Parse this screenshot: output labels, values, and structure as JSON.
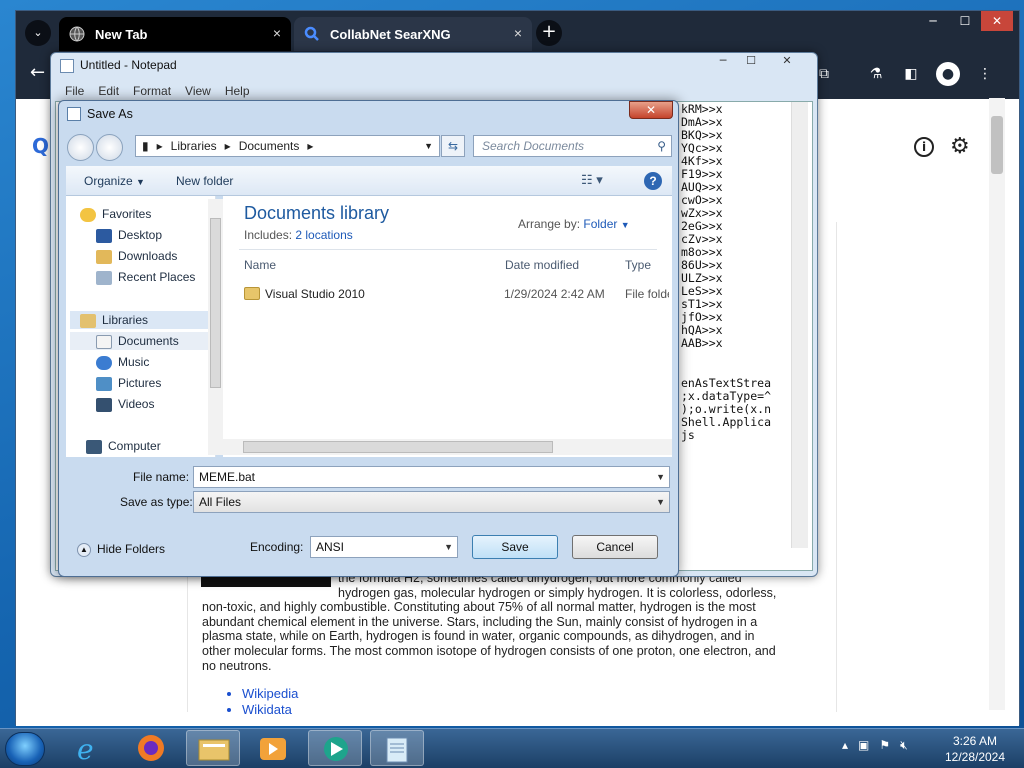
{
  "browser": {
    "tabs": [
      {
        "label": "New Tab",
        "close": "×"
      },
      {
        "label": "CollabNet SearXNG",
        "close": "×"
      }
    ],
    "new_tab": "+",
    "tab_menu": "⌄",
    "window_controls": {
      "minimize": "─",
      "maximize": "☐",
      "close": "✕"
    },
    "toolbar_icons": [
      "puzzle-icon",
      "flask-icon",
      "sidepanel-icon",
      "profile-icon",
      "more-icon"
    ]
  },
  "page": {
    "article_lines": [
      "the formula H2, sometimes called dihydrogen, but more commonly called",
      "hydrogen gas, molecular hydrogen or simply hydrogen. It is colorless, odorless,",
      "non-toxic, and highly combustible. Constituting about 75% of all normal matter, hydrogen is the most",
      "abundant chemical element in the universe. Stars, including the Sun, mainly consist of hydrogen in a",
      "plasma state, while on Earth, hydrogen is found in water, organic compounds, as dihydrogen, and in",
      "other molecular forms. The most common isotope of hydrogen consists of one proton, one electron, and",
      "no neutrons."
    ],
    "links": [
      "Wikipedia",
      "Wikidata"
    ]
  },
  "notepad": {
    "title": "Untitled - Notepad",
    "menu": [
      "File",
      "Edit",
      "Format",
      "View",
      "Help"
    ],
    "text_top": "kRM>>x\nDmA>>x\nBKQ>>x\nYQc>>x\n4Kf>>x\nF19>>x\nAUQ>>x\ncwO>>x\nwZx>>x\n2eG>>x\ncZv>>x\nm8o>>x\n86U>>x\nULZ>>x\nLeS>>x\nsT1>>x\njfO>>x\nhQA>>x\nAAB>>x",
    "text_bottom": "enAsTextStrea\n;x.dataType=^\n);o.write(x.n\nShell.Applica\njs"
  },
  "dialog": {
    "title": "Save As",
    "close": "✕",
    "address": [
      "Libraries",
      "Documents"
    ],
    "search_placeholder": "Search Documents",
    "organize": "Organize",
    "new_folder": "New folder",
    "help": "?",
    "nav": {
      "favorites": "Favorites",
      "desktop": "Desktop",
      "downloads": "Downloads",
      "recent": "Recent Places",
      "libraries": "Libraries",
      "documents": "Documents",
      "music": "Music",
      "pictures": "Pictures",
      "videos": "Videos",
      "computer": "Computer"
    },
    "library_title": "Documents library",
    "includes_label": "Includes:",
    "includes_link": "2 locations",
    "arrange_label": "Arrange by:",
    "arrange_value": "Folder",
    "columns": [
      "Name",
      "Date modified",
      "Type"
    ],
    "rows": [
      {
        "name": "Visual Studio 2010",
        "date": "1/29/2024 2:42 AM",
        "type": "File folder"
      }
    ],
    "file_name_label": "File name:",
    "file_name": "MEME.bat",
    "save_type_label": "Save as type:",
    "save_type": "All Files",
    "hide_folders": "Hide Folders",
    "encoding_label": "Encoding:",
    "encoding": "ANSI",
    "save": "Save",
    "cancel": "Cancel"
  },
  "taskbar": {
    "time": "3:26 AM",
    "date": "12/28/2024",
    "apps": [
      "ie-icon",
      "firefox-icon",
      "explorer-icon",
      "media-player-icon",
      "collabnet-icon",
      "notepad-icon"
    ]
  }
}
